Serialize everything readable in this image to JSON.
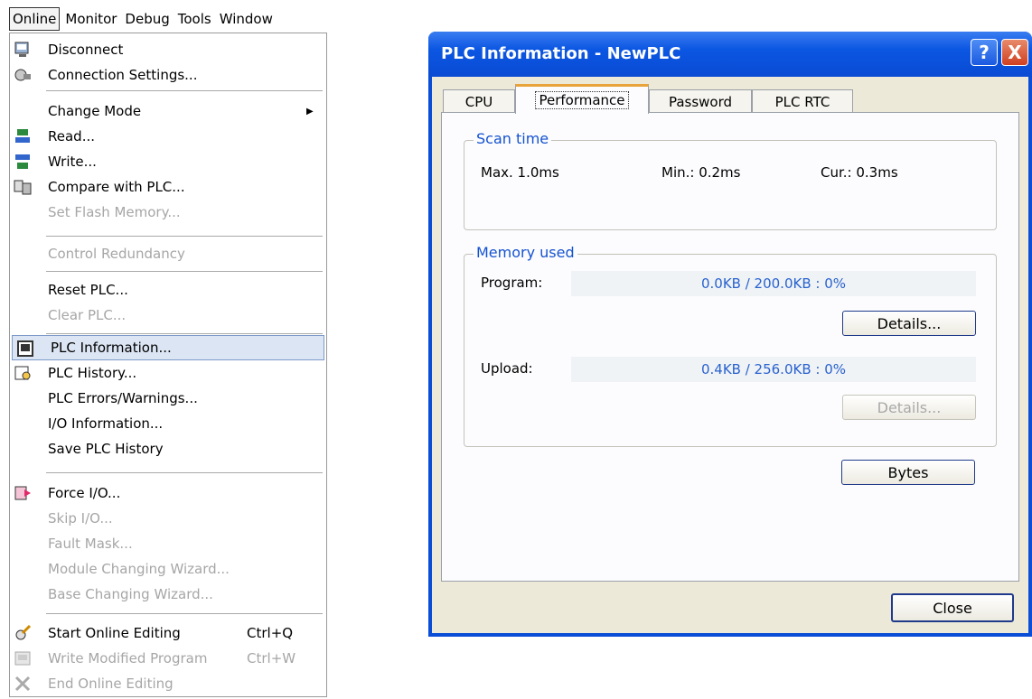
{
  "menubar": {
    "items": [
      {
        "label": "Online",
        "active": true
      },
      {
        "label": "Monitor",
        "active": false
      },
      {
        "label": "Debug",
        "active": false
      },
      {
        "label": "Tools",
        "active": false
      },
      {
        "label": "Window",
        "active": false
      }
    ]
  },
  "online_menu": {
    "items": {
      "disconnect": "Disconnect",
      "connection_settings": "Connection Settings...",
      "change_mode": "Change Mode",
      "read": "Read...",
      "write": "Write...",
      "compare": "Compare with PLC...",
      "set_flash": "Set Flash Memory...",
      "control_redundancy": "Control Redundancy",
      "reset_plc": "Reset PLC...",
      "clear_plc": "Clear PLC...",
      "plc_information": "PLC Information...",
      "plc_history": "PLC History...",
      "plc_errors": "PLC Errors/Warnings...",
      "io_information": "I/O Information...",
      "save_history": "Save PLC History",
      "force_io": "Force I/O...",
      "skip_io": "Skip I/O...",
      "fault_mask": "Fault Mask...",
      "module_wizard": "Module Changing Wizard...",
      "base_wizard": "Base Changing Wizard...",
      "start_online_editing": "Start Online Editing",
      "start_online_editing_sc": "Ctrl+Q",
      "write_modified": "Write Modified Program",
      "write_modified_sc": "Ctrl+W",
      "end_online_editing": "End Online Editing"
    }
  },
  "dialog": {
    "title": "PLC Information - NewPLC",
    "help_glyph": "?",
    "close_glyph": "X",
    "tabs": [
      "CPU",
      "Performance",
      "Password",
      "PLC RTC"
    ],
    "active_tab": "Performance",
    "scan_time": {
      "label": "Scan time",
      "max": "Max. 1.0ms",
      "min": "Min.: 0.2ms",
      "cur": "Cur.: 0.3ms"
    },
    "memory": {
      "label": "Memory used",
      "program_label": "Program:",
      "program_value": "0.0KB / 200.0KB : 0%",
      "details1": "Details...",
      "upload_label": "Upload:",
      "upload_value": "0.4KB / 256.0KB : 0%",
      "details2": "Details..."
    },
    "bytes_button": "Bytes",
    "close_button": "Close"
  }
}
